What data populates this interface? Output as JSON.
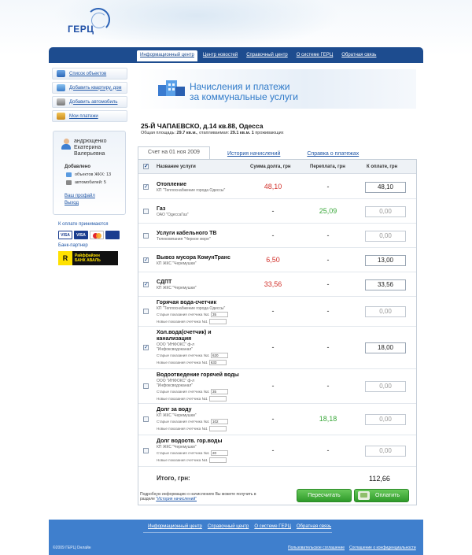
{
  "logo": {
    "text": "ГЕРЦ"
  },
  "nav": [
    "Информационный центр",
    "Центр новостей",
    "Справочный центр",
    "О системе ГЕРЦ",
    "Обратная связь"
  ],
  "sidebar": [
    {
      "label": "Список объектов",
      "icon": "list-icon"
    },
    {
      "label": "Добавить квартиру, дом",
      "icon": "house-icon"
    },
    {
      "label": "Добавить автомобиль",
      "icon": "car-icon"
    },
    {
      "label": "Мои платежи",
      "icon": "payments-icon"
    }
  ],
  "user": {
    "name1": "андрющенко",
    "name2": "Екатерина",
    "name3": "Валерьевна",
    "added_label": "Добавлено",
    "objects": "объектов ЖКХ: 13",
    "cars": "автомобилей: 5",
    "profile": "Ваш профайл",
    "logout": "Выход"
  },
  "payments_accepted": "К оплате принимаются",
  "cards": [
    "VISA",
    "VISA"
  ],
  "bank_partner": "Банк-партнер",
  "bank": {
    "mark": "R",
    "line1": "Райффайзен",
    "line2": "БАНК АВАЛЬ"
  },
  "header": {
    "line1": "Начисления и платежи",
    "line2": "за коммунальные услуги"
  },
  "address": "25-Й ЧАПАЕВСКО, д.14 кв.88, Одесса",
  "area": {
    "prefix": "Общая площадь:",
    "total": "29.7 кв.м.",
    "heated_prefix": ", отапливаемая:",
    "heated": "29.1 кв.м.",
    "residents": "1",
    "residents_suffix": "проживающих"
  },
  "tabs": [
    "Счет на 01 ноя 2009",
    "История начислений",
    "Справка о платежах"
  ],
  "columns": {
    "service": "Название услуги",
    "debt": "Сумма долга, грн",
    "overpay": "Переплата, грн",
    "topay": "К оплате, грн"
  },
  "rows": [
    {
      "title": "Отопление",
      "provider": "КП \"Теплоснабжение города Одессы\"",
      "debt": "48,10",
      "debt_color": "red",
      "over": "-",
      "over_color": "dash",
      "topay": "48,10",
      "checked": true
    },
    {
      "title": "Газ",
      "provider": "ОАО \"ОдессаГаз\"",
      "debt": "-",
      "debt_color": "dash",
      "over": "25,09",
      "over_color": "green",
      "topay": "0,00",
      "checked": false
    },
    {
      "title": "Услуги кабельного ТВ",
      "provider": "Телекомпания \"Черное море\"",
      "debt": "-",
      "debt_color": "dash",
      "over": "-",
      "over_color": "dash",
      "topay": "0,00",
      "checked": false
    },
    {
      "title": "Вывоз мусора КомунТранс",
      "provider": "КП ЖКС \"Черемушки\"",
      "debt": "6,50",
      "debt_color": "red",
      "over": "-",
      "over_color": "dash",
      "topay": "13,00",
      "checked": true
    },
    {
      "title": "СДПТ",
      "provider": "КП ЖКС \"Черемушки\"",
      "debt": "33,56",
      "debt_color": "red",
      "over": "-",
      "over_color": "dash",
      "topay": "33,56",
      "checked": true
    },
    {
      "title": "Горячая вода-счетчик",
      "provider": "КП \"Теплоснабжение города Одессы\"",
      "meter_old_label": "Старые показания счетчика №1",
      "meter_old": "35",
      "meter_new_label": "Новые показания счетчика №1",
      "meter_new": "",
      "debt": "-",
      "debt_color": "dash",
      "over": "-",
      "over_color": "dash",
      "topay": "0,00",
      "checked": false
    },
    {
      "title": "Хол.вода(счетчик) и",
      "title2": "канализация",
      "provider": "ООО \"ИНФОКС\" ф-л",
      "provider2": "\"Инфоксводоканал\"",
      "meter_old_label": "Старые показания счетчика №1",
      "meter_old": "620",
      "meter_new_label": "Новые показания счетчика №1",
      "meter_new": "633",
      "debt": "-",
      "debt_color": "dash",
      "over": "-",
      "over_color": "dash",
      "topay": "18,00",
      "checked": true
    },
    {
      "title": "Водоотведение горячей воды",
      "provider": "ООО \"ИНФОКС\" ф-л",
      "provider2": "\"Инфоксводоканал\"",
      "meter_old_label": "Старые показания счетчика №1",
      "meter_old": "35",
      "meter_new_label": "Новые показания счетчика №1",
      "meter_new": "",
      "debt": "-",
      "debt_color": "dash",
      "over": "-",
      "over_color": "dash",
      "topay": "0,00",
      "checked": false
    },
    {
      "title": "Долг за воду",
      "provider": "КП ЖКС \"Черемушки\"",
      "meter_old_label": "Старые показания счетчика №1",
      "meter_old": "102",
      "meter_new_label": "Новые показания счетчика №1",
      "meter_new": "",
      "debt": "-",
      "debt_color": "dash",
      "over": "18,18",
      "over_color": "green",
      "topay": "0,00",
      "checked": false
    },
    {
      "title": "Долг водоотв. гор.воды",
      "provider": "КП ЖКС \"Черемушки\"",
      "meter_old_label": "Старые показания счетчика №1",
      "meter_old": "20",
      "meter_new_label": "Новые показания счетчика №1",
      "meter_new": "",
      "debt": "-",
      "debt_color": "dash",
      "over": "-",
      "over_color": "dash",
      "topay": "0,00",
      "checked": false
    }
  ],
  "total": {
    "label": "Итого, грн:",
    "value": "112,66"
  },
  "note": {
    "text": "Подробную информацию о начислениях Вы можете получить в разделе",
    "link": "\"История начислений\""
  },
  "buttons": {
    "recalc": "Пересчитать",
    "pay": "Оплатить"
  },
  "footer": {
    "links": [
      "Информационный центр",
      "Справочный центр",
      "О системе ГЕРЦ",
      "Обратная связь"
    ],
    "copyright": "©2009 ГЕРЦ Онлайн",
    "agreement": "Пользовательское соглашение",
    "privacy": "Соглашение о конфиденциальности"
  },
  "colors": {
    "nav": "#1d4c8f",
    "footer": "#3f7fcd",
    "debt": "#d2302a",
    "overpay": "#3aa83a",
    "button": "#3aa83a"
  }
}
